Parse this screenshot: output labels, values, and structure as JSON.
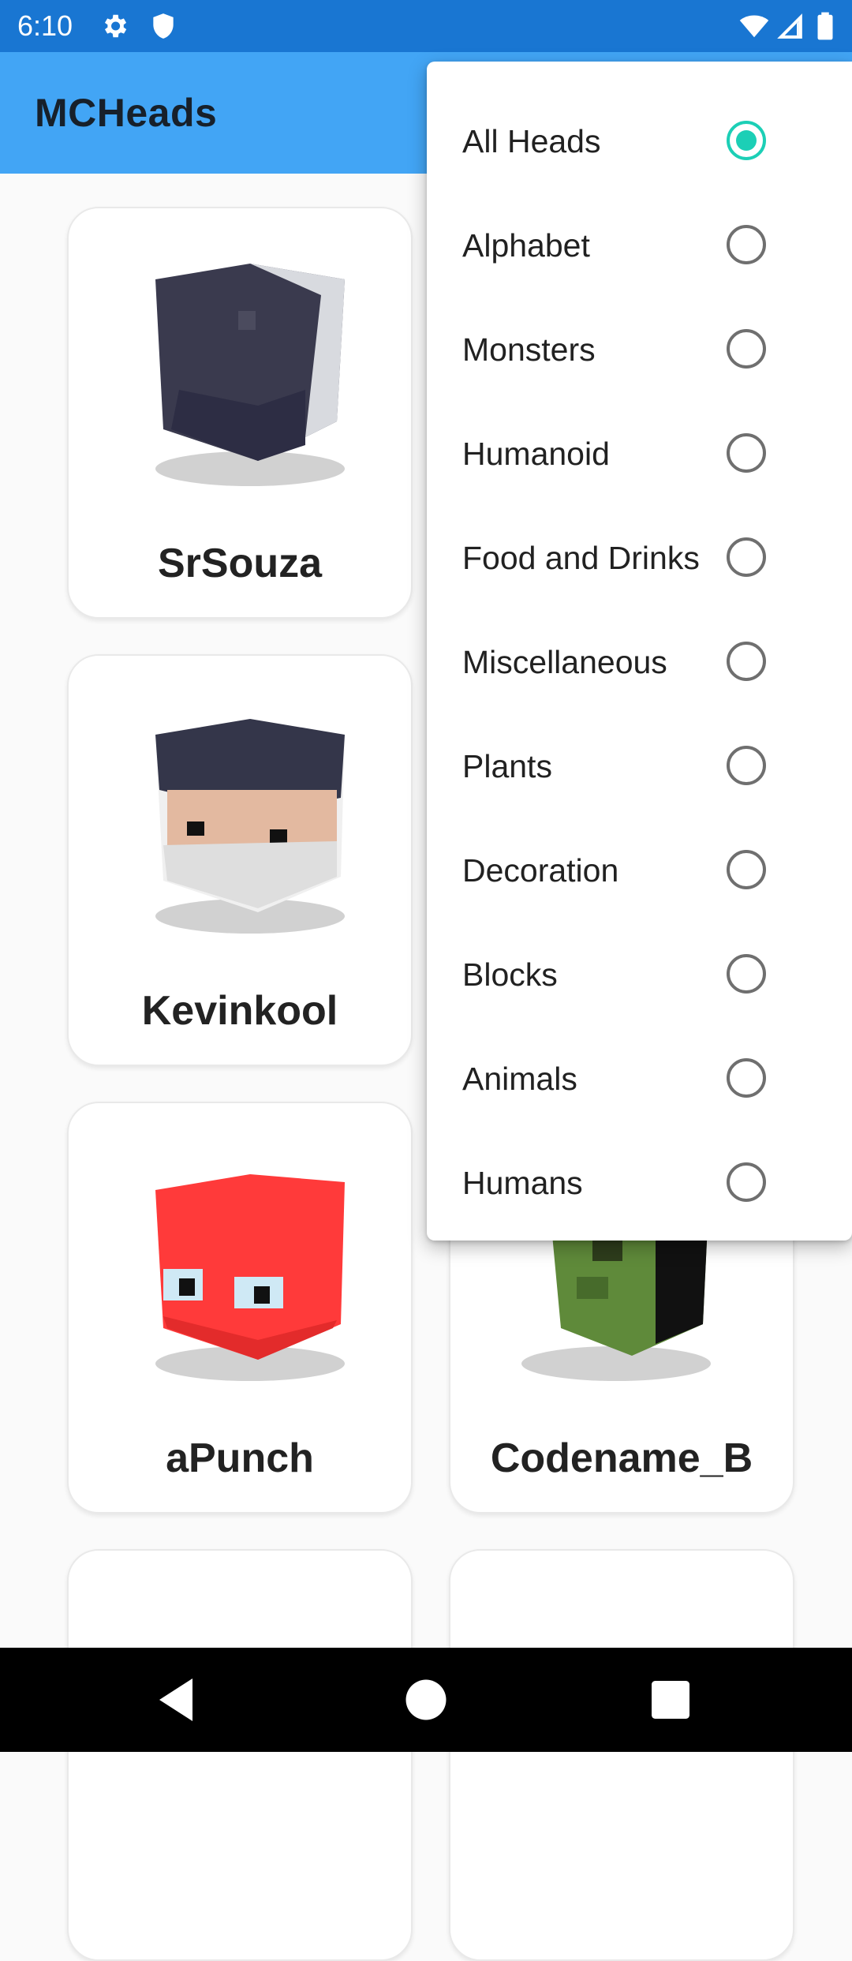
{
  "status_bar": {
    "time": "6:10",
    "icons": [
      "settings-icon",
      "shield-icon",
      "wifi-icon",
      "signal-icon",
      "battery-icon"
    ]
  },
  "app_bar": {
    "title": "MCHeads"
  },
  "cards": [
    {
      "name": "SrSouza"
    },
    {
      "name": "Kevinkool"
    },
    {
      "name": "aPunch"
    },
    {
      "name": "Codename_B"
    }
  ],
  "menu": {
    "items": [
      {
        "label": "All Heads",
        "selected": true
      },
      {
        "label": "Alphabet",
        "selected": false
      },
      {
        "label": "Monsters",
        "selected": false
      },
      {
        "label": "Humanoid",
        "selected": false
      },
      {
        "label": "Food and Drinks",
        "selected": false
      },
      {
        "label": "Miscellaneous",
        "selected": false
      },
      {
        "label": "Plants",
        "selected": false
      },
      {
        "label": "Decoration",
        "selected": false
      },
      {
        "label": "Blocks",
        "selected": false
      },
      {
        "label": "Animals",
        "selected": false
      },
      {
        "label": "Humans",
        "selected": false
      }
    ]
  },
  "colors": {
    "status_bar": "#1976d2",
    "app_bar": "#42a5f5",
    "radio_selected": "#1ccfb6"
  },
  "nav_bar": {
    "icons": [
      "back-icon",
      "home-icon",
      "recents-icon"
    ]
  }
}
